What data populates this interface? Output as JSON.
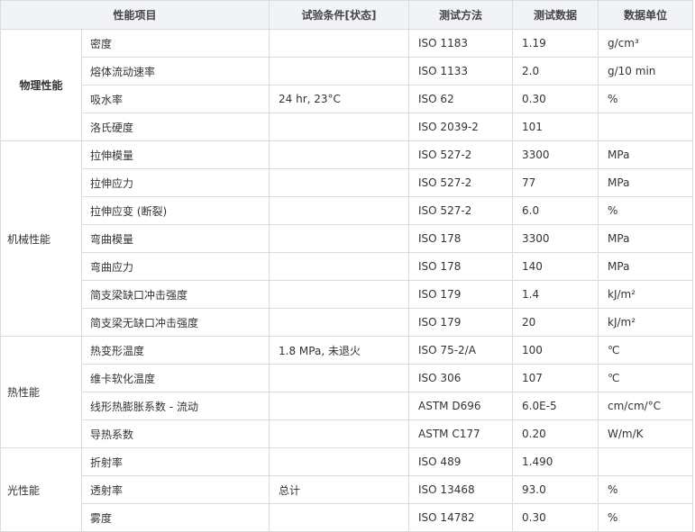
{
  "headers": [
    "性能项目",
    "试验条件[状态]",
    "测试方法",
    "测试数据",
    "数据单位"
  ],
  "categories": [
    {
      "name": "物理性能",
      "bold": true,
      "rows": [
        {
          "item": "密度",
          "cond": "",
          "method": "ISO 1183",
          "value": "1.19",
          "unit": "g/cm³"
        },
        {
          "item": "熔体流动速率",
          "cond": "",
          "method": "ISO 1133",
          "value": "2.0",
          "unit": "g/10 min"
        },
        {
          "item": "吸水率",
          "cond": "24 hr, 23°C",
          "method": "ISO 62",
          "value": "0.30",
          "unit": "%"
        },
        {
          "item": "洛氏硬度",
          "cond": "",
          "method": "ISO 2039-2",
          "value": "101",
          "unit": ""
        }
      ]
    },
    {
      "name": "机械性能",
      "bold": false,
      "rows": [
        {
          "item": "拉伸模量",
          "cond": "",
          "method": "ISO 527-2",
          "value": "3300",
          "unit": "MPa"
        },
        {
          "item": "拉伸应力",
          "cond": "",
          "method": "ISO 527-2",
          "value": "77",
          "unit": "MPa"
        },
        {
          "item": "拉伸应变 (断裂)",
          "cond": "",
          "method": "ISO 527-2",
          "value": "6.0",
          "unit": "%"
        },
        {
          "item": "弯曲模量",
          "cond": "",
          "method": "ISO 178",
          "value": "3300",
          "unit": "MPa"
        },
        {
          "item": "弯曲应力",
          "cond": "",
          "method": "ISO 178",
          "value": "140",
          "unit": "MPa"
        },
        {
          "item": "简支梁缺口冲击强度",
          "cond": "",
          "method": "ISO 179",
          "value": "1.4",
          "unit": "kJ/m²"
        },
        {
          "item": "简支梁无缺口冲击强度",
          "cond": "",
          "method": "ISO 179",
          "value": "20",
          "unit": "kJ/m²"
        }
      ]
    },
    {
      "name": "热性能",
      "bold": false,
      "rows": [
        {
          "item": "热变形温度",
          "cond": "1.8 MPa, 未退火",
          "method": "ISO 75-2/A",
          "value": "100",
          "unit": "℃"
        },
        {
          "item": "维卡软化温度",
          "cond": "",
          "method": "ISO 306",
          "value": "107",
          "unit": "℃"
        },
        {
          "item": "线形热膨胀系数 - 流动",
          "cond": "",
          "method": "ASTM D696",
          "value": "6.0E-5",
          "unit": "cm/cm/°C"
        },
        {
          "item": "导热系数",
          "cond": "",
          "method": "ASTM C177",
          "value": "0.20",
          "unit": "W/m/K"
        }
      ]
    },
    {
      "name": "光性能",
      "bold": false,
      "rows": [
        {
          "item": "折射率",
          "cond": "",
          "method": "ISO 489",
          "value": "1.490",
          "unit": ""
        },
        {
          "item": "透射率",
          "cond": "总计",
          "method": "ISO 13468",
          "value": "93.0",
          "unit": "%"
        },
        {
          "item": "雾度",
          "cond": "",
          "method": "ISO 14782",
          "value": "0.30",
          "unit": "%"
        }
      ]
    }
  ]
}
